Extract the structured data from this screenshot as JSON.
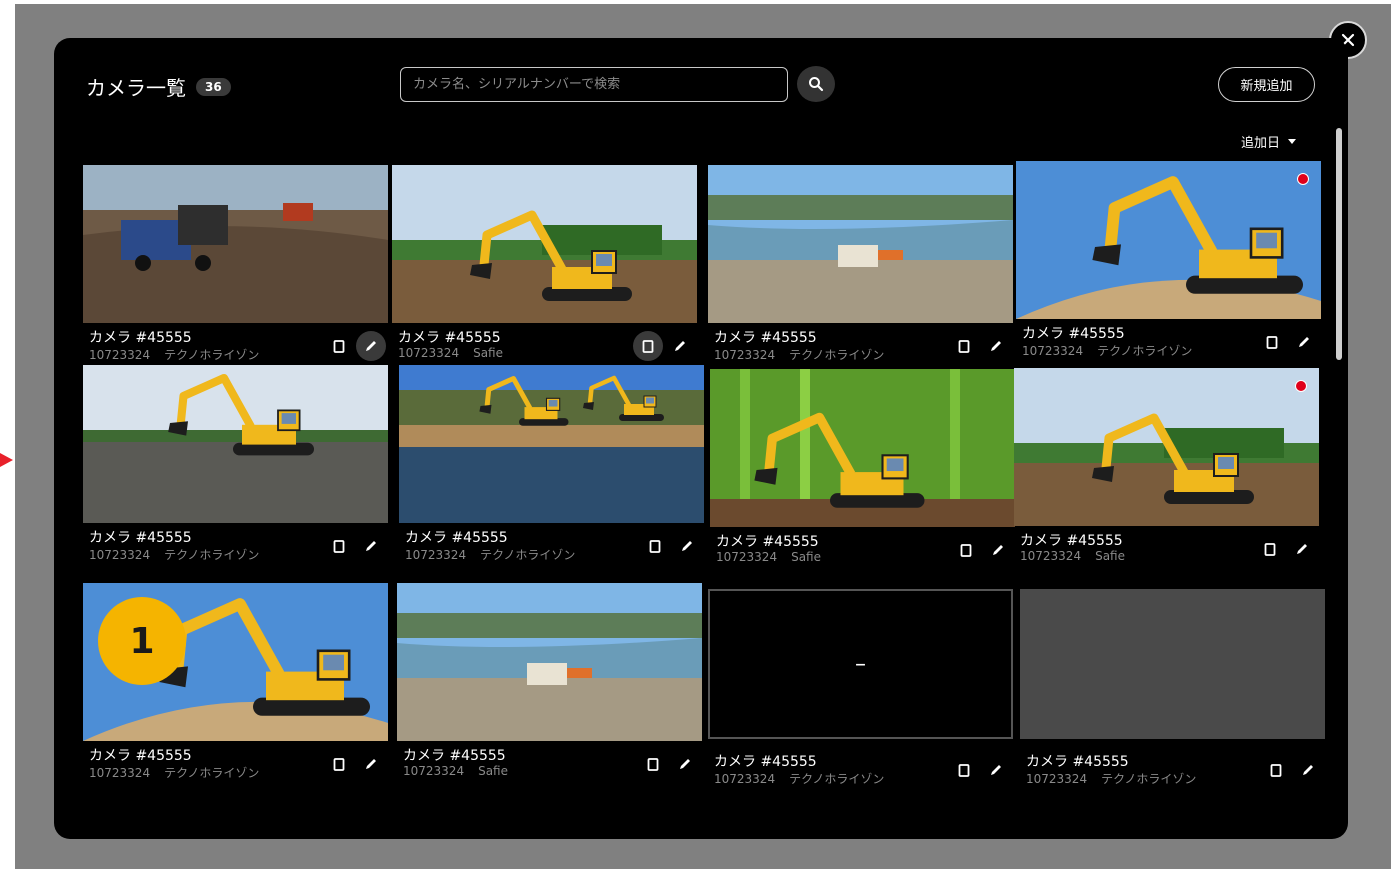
{
  "modal": {
    "title": "カメラ一覧",
    "count": "36",
    "search_placeholder": "カメラ名、シリアルナンバーで検索",
    "add_button": "新規追加",
    "sort_label": "追加日",
    "close_icon": "close-icon"
  },
  "cameras": [
    {
      "name": "カメラ #45555",
      "serial": "10723324",
      "provider": "テクノホライゾン",
      "thumb": "dump-truck"
    },
    {
      "name": "カメラ #45555",
      "serial": "10723324",
      "provider": "Safie",
      "thumb": "excavator-field"
    },
    {
      "name": "カメラ #45555",
      "serial": "10723324",
      "provider": "テクノホライゾン",
      "thumb": "river"
    },
    {
      "name": "カメラ #45555",
      "serial": "10723324",
      "provider": "テクノホライゾン",
      "thumb": "excavator-sky",
      "recording": true
    },
    {
      "name": "カメラ #45555",
      "serial": "10723324",
      "provider": "テクノホライゾン",
      "thumb": "excavator-gravel"
    },
    {
      "name": "カメラ #45555",
      "serial": "10723324",
      "provider": "テクノホライゾン",
      "thumb": "lake"
    },
    {
      "name": "カメラ #45555",
      "serial": "10723324",
      "provider": "Safie",
      "thumb": "bamboo"
    },
    {
      "name": "カメラ #45555",
      "serial": "10723324",
      "provider": "Safie",
      "thumb": "excavator-field",
      "recording": true
    },
    {
      "name": "カメラ #45555",
      "serial": "10723324",
      "provider": "テクノホライゾン",
      "thumb": "excavator-sky",
      "badge": "1"
    },
    {
      "name": "カメラ #45555",
      "serial": "10723324",
      "provider": "Safie",
      "thumb": "river"
    },
    {
      "name": "カメラ #45555",
      "serial": "10723324",
      "provider": "テクノホライゾン",
      "thumb": "empty",
      "empty_text": "–"
    },
    {
      "name": "カメラ #45555",
      "serial": "10723324",
      "provider": "テクノホライゾン",
      "thumb": "gray"
    }
  ],
  "colors": {
    "accent": "#f5b400",
    "recording": "#e0001a",
    "background": "#000000"
  }
}
